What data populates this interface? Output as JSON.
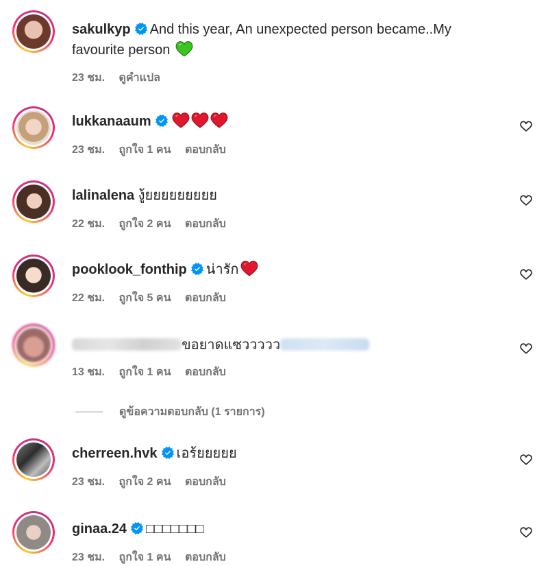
{
  "comments": [
    {
      "username": "sakulkyp",
      "verified": true,
      "text": "And this year, An unexpected person became..My favourite person",
      "emoji": "green-heart",
      "time": "23 ชม.",
      "see_translation": "ดูคำแปล"
    },
    {
      "username": "lukkanaaum",
      "verified": true,
      "text": "",
      "emoji": "three-red-hearts",
      "time": "23 ชม.",
      "likes": "ถูกใจ 1 คน",
      "reply": "ตอบกลับ"
    },
    {
      "username": "lalinalena",
      "verified": false,
      "text": "งู้ยยยยยยยยย",
      "time": "22 ชม.",
      "likes": "ถูกใจ 2 คน",
      "reply": "ตอบกลับ"
    },
    {
      "username": "pooklook_fonthip",
      "verified": true,
      "text": "น่ารัก",
      "emoji": "red-heart",
      "time": "22 ชม.",
      "likes": "ถูกใจ 5 คน",
      "reply": "ตอบกลับ"
    },
    {
      "username": "",
      "verified": false,
      "text": "ขอยาดแซววววว",
      "time": "13 ชม.",
      "likes": "ถูกใจ 1 คน",
      "reply": "ตอบกลับ"
    },
    {
      "username": "cherreen.hvk",
      "verified": true,
      "text": "เอร้ยยยยย",
      "time": "23 ชม.",
      "likes": "ถูกใจ 2 คน",
      "reply": "ตอบกลับ"
    },
    {
      "username": "ginaa.24",
      "verified": true,
      "text": "□□□□□□□",
      "time": "23 ชม.",
      "likes": "ถูกใจ 1 คน",
      "reply": "ตอบกลับ"
    }
  ],
  "view_replies": "ดูข้อความตอบกลับ (1 รายการ)",
  "colors": {
    "verified": "#0095f6",
    "meta": "#737373",
    "ring_start": "#f9ce34",
    "ring_mid": "#ee2a7b"
  },
  "icons": {
    "like": "heart-outline-icon",
    "verified": "verified-badge-icon"
  }
}
